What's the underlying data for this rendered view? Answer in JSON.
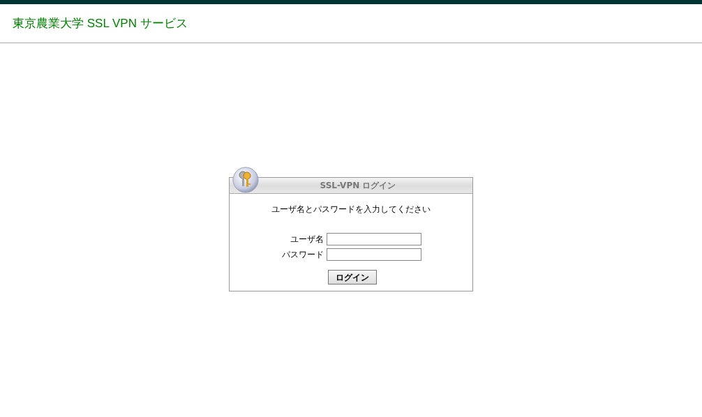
{
  "header": {
    "title": "東京農業大学 SSL VPN サービス"
  },
  "login_panel": {
    "title": "SSL-VPN ログイン",
    "instruction": "ユーザ名とパスワードを入力してください",
    "fields": [
      {
        "label": "ユーザ名"
      },
      {
        "label": "パスワード"
      }
    ],
    "button": "ログイン"
  }
}
